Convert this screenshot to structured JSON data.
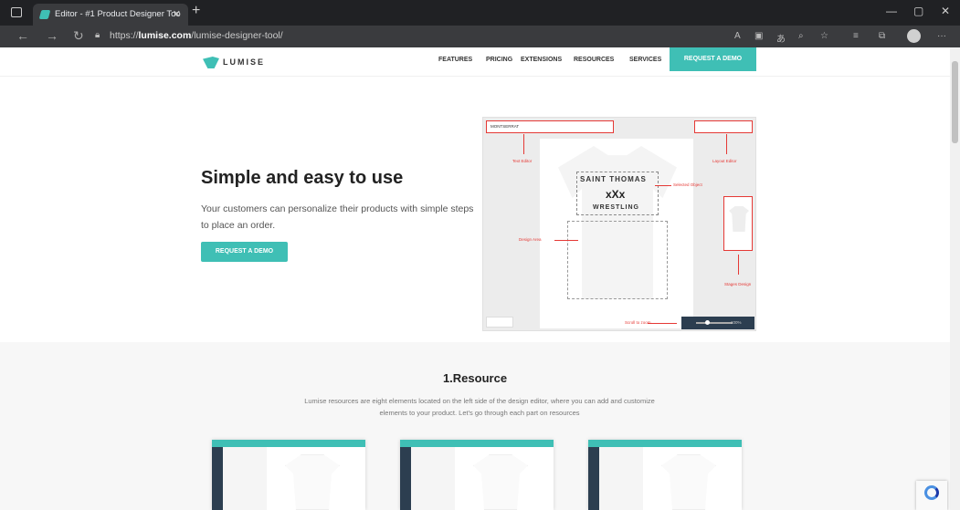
{
  "browser": {
    "tab_title": "Editor - #1 Product Designer Too",
    "url_prefix": "https://",
    "url_domain": "lumise.com",
    "url_path": "/lumise-designer-tool/"
  },
  "site": {
    "logo_text": "LUMISE",
    "menu": [
      "FEATURES",
      "PRICING",
      "EXTENSIONS",
      "RESOURCES",
      "SERVICES"
    ],
    "cta": "REQUEST A DEMO"
  },
  "hero": {
    "title": "Simple and easy to use",
    "subtitle": "Your customers can personalize their products with simple steps to place an order.",
    "button": "REQUEST A DEMO"
  },
  "editor_preview": {
    "font_name": "MONTSERRAT",
    "shirt_line1": "SAINT THOMAS",
    "shirt_line2": "xXx",
    "shirt_line3": "WRESTLING",
    "annotations": {
      "text_editor": "Text Editor",
      "layout_editor": "Layout Editor",
      "selected_object": "Selected Object",
      "design_area": "Design Area",
      "stages_design": "Stages Design",
      "scroll_to_zoom": "Scroll to zoom"
    },
    "zoom_value": "100%"
  },
  "section": {
    "title": "1.Resource",
    "description": "Lumise resources are eight elements located on the left side of the design editor, where you can add and customize elements to your product. Let's go through each part on resources"
  },
  "colors": {
    "accent": "#3fbfb5",
    "annotation": "#e53935"
  }
}
